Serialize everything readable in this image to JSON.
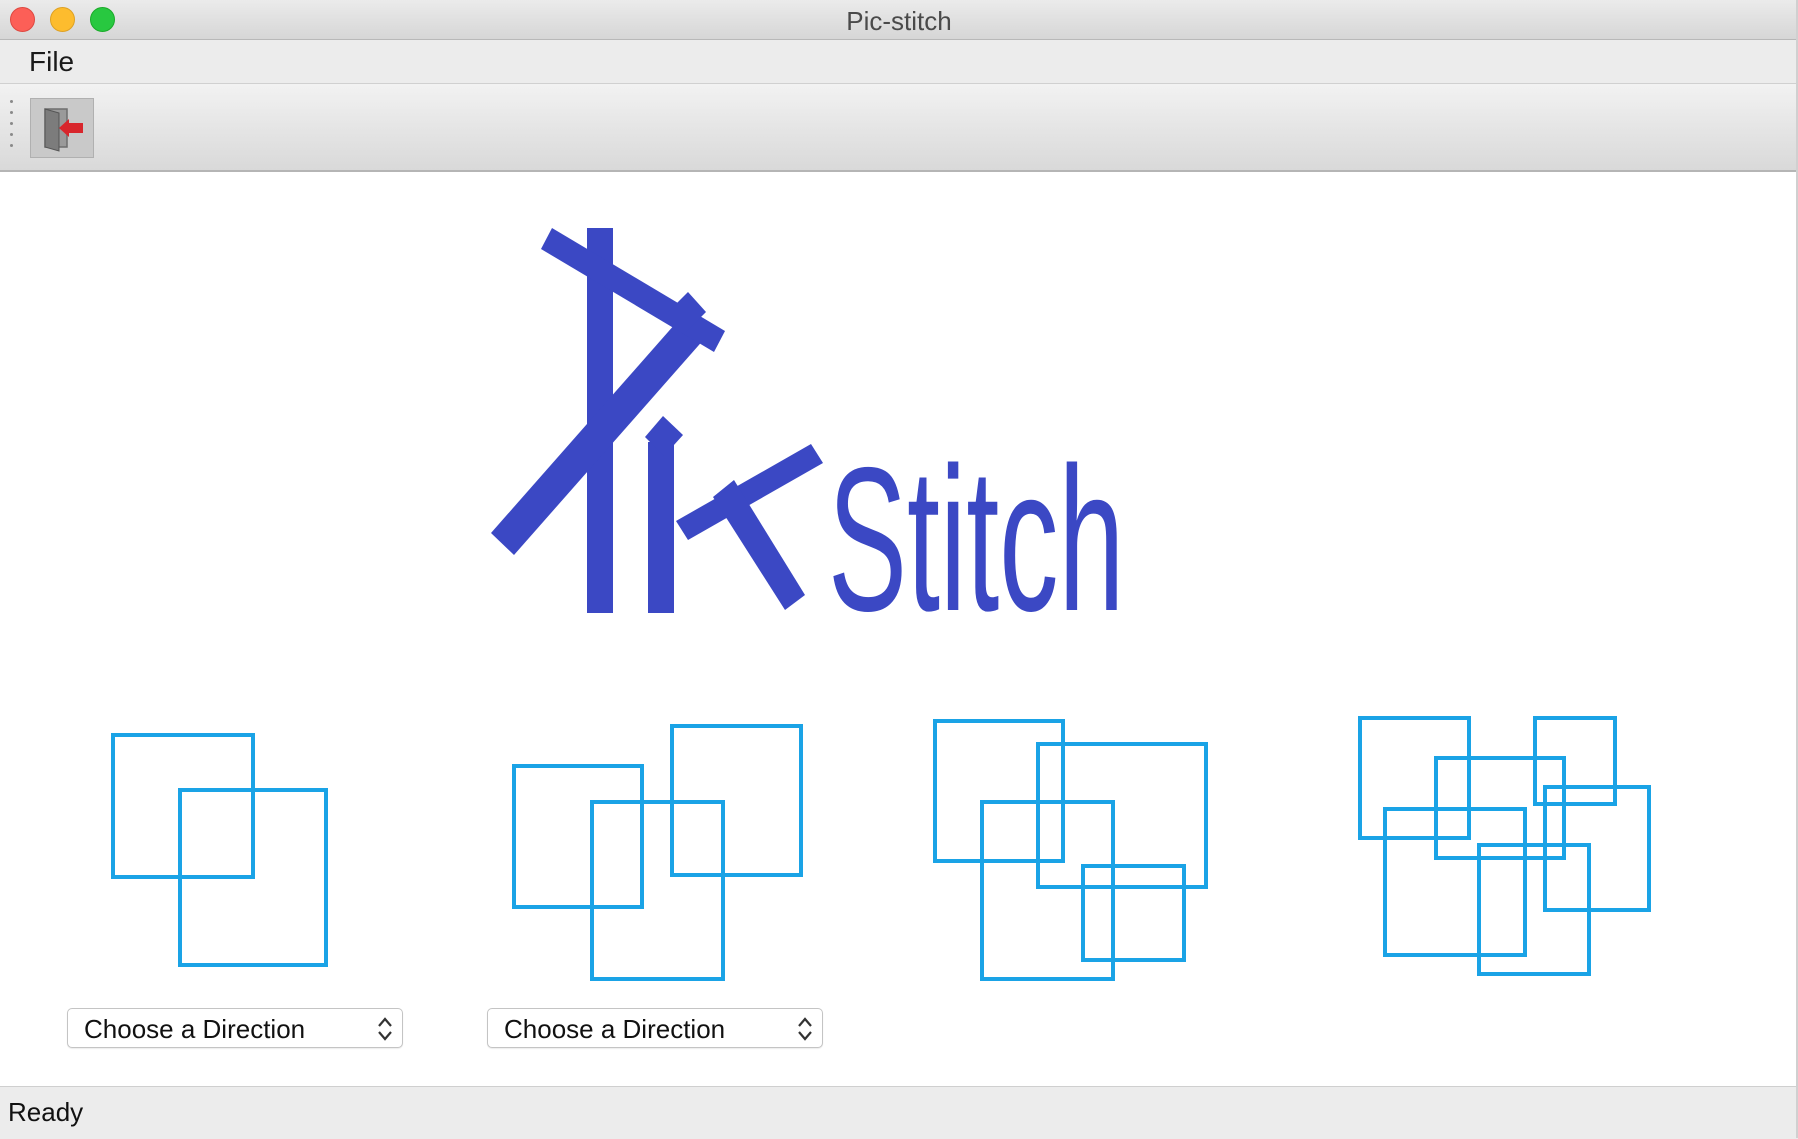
{
  "window": {
    "title": "Pic-stitch"
  },
  "menubar": {
    "items": [
      {
        "label": "File"
      }
    ]
  },
  "toolbar": {
    "buttons": [
      {
        "icon": "exit-door-icon"
      }
    ]
  },
  "logo": {
    "text_tail": "Stitch",
    "color": "#3b48c4"
  },
  "layouts": [
    {
      "name": "two-images-layout",
      "direction_select": "Choose a Direction"
    },
    {
      "name": "three-images-layout",
      "direction_select": "Choose a Direction"
    },
    {
      "name": "four-images-layout"
    },
    {
      "name": "six-images-layout"
    }
  ],
  "accent_color": "#1aa3e6",
  "statusbar": {
    "text": "Ready"
  }
}
